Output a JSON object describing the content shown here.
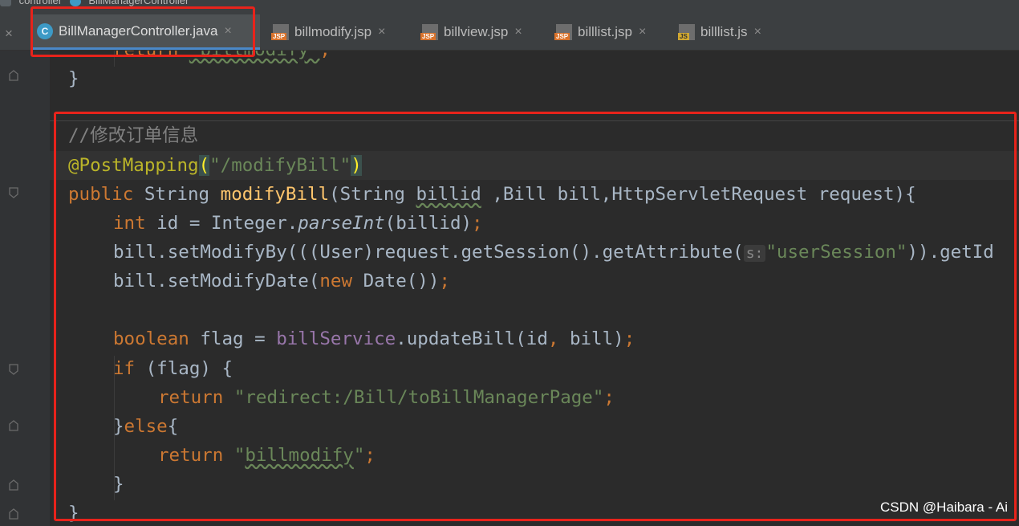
{
  "breadcrumb": {
    "items": [
      "controller",
      "BillManagerController"
    ]
  },
  "tabs": [
    {
      "label": "BillManagerController.java",
      "icon": "java-class-icon",
      "active": true
    },
    {
      "label": "billmodify.jsp",
      "icon": "jsp-file-icon",
      "active": false
    },
    {
      "label": "billview.jsp",
      "icon": "jsp-file-icon",
      "active": false
    },
    {
      "label": "billlist.jsp",
      "icon": "jsp-file-icon",
      "active": false
    },
    {
      "label": "billlist.js",
      "icon": "js-file-icon",
      "active": false
    }
  ],
  "tab_close_glyph": "×",
  "code": {
    "l0": {
      "kw": "return",
      "str": "\"billmodify\"",
      "semi": ";"
    },
    "l1": "}",
    "l2": "//修改订单信息",
    "l3": {
      "ann": "@PostMapping",
      "open": "(",
      "str": "\"/modifyBill\"",
      "close": ")"
    },
    "l4": {
      "kw": "public",
      "t1": " String ",
      "fn": "modifyBill",
      "t2": "(String ",
      "p1": "billid",
      "t3": " ,Bill bill,HttpServletRequest request){"
    },
    "l5": {
      "kw": "int",
      "t1": " id = Integer.",
      "fn": "parseInt",
      "t2": "(billid)",
      "semi": ";"
    },
    "l6": {
      "t1": "bill.setModifyBy(((User)request.getSession().getAttribute(",
      "hint": "s:",
      "str": "\"userSession\"",
      "t2": ")).getId"
    },
    "l7": {
      "t1": "bill.setModifyDate(",
      "kw": "new",
      "t2": " Date())",
      "semi": ";"
    },
    "l8": {
      "kw": "boolean",
      "t1": " flag = ",
      "fld": "billService",
      "t2": ".updateBill(id",
      "comma": ",",
      "t3": " bill)",
      "semi": ";"
    },
    "l9": {
      "kw": "if",
      "t1": " (flag) {"
    },
    "l10": {
      "kw": "return",
      "str": "\"redirect:/Bill/toBillManagerPage\"",
      "semi": ";"
    },
    "l11": {
      "t1": "}",
      "kw": "else",
      "t2": "{"
    },
    "l12": {
      "kw": "return",
      "str1": "\"",
      "str2": "billmodify",
      "str3": "\"",
      "semi": ";"
    },
    "l13": "}",
    "l14": "}"
  },
  "watermark": "CSDN @Haibara - Ai",
  "colors": {
    "keyword": "#cc7832",
    "string": "#6a8759",
    "annotation": "#bbb529",
    "function": "#ffc66d",
    "field": "#9876aa",
    "comment": "#808080",
    "highlight_box": "#e8231b"
  }
}
